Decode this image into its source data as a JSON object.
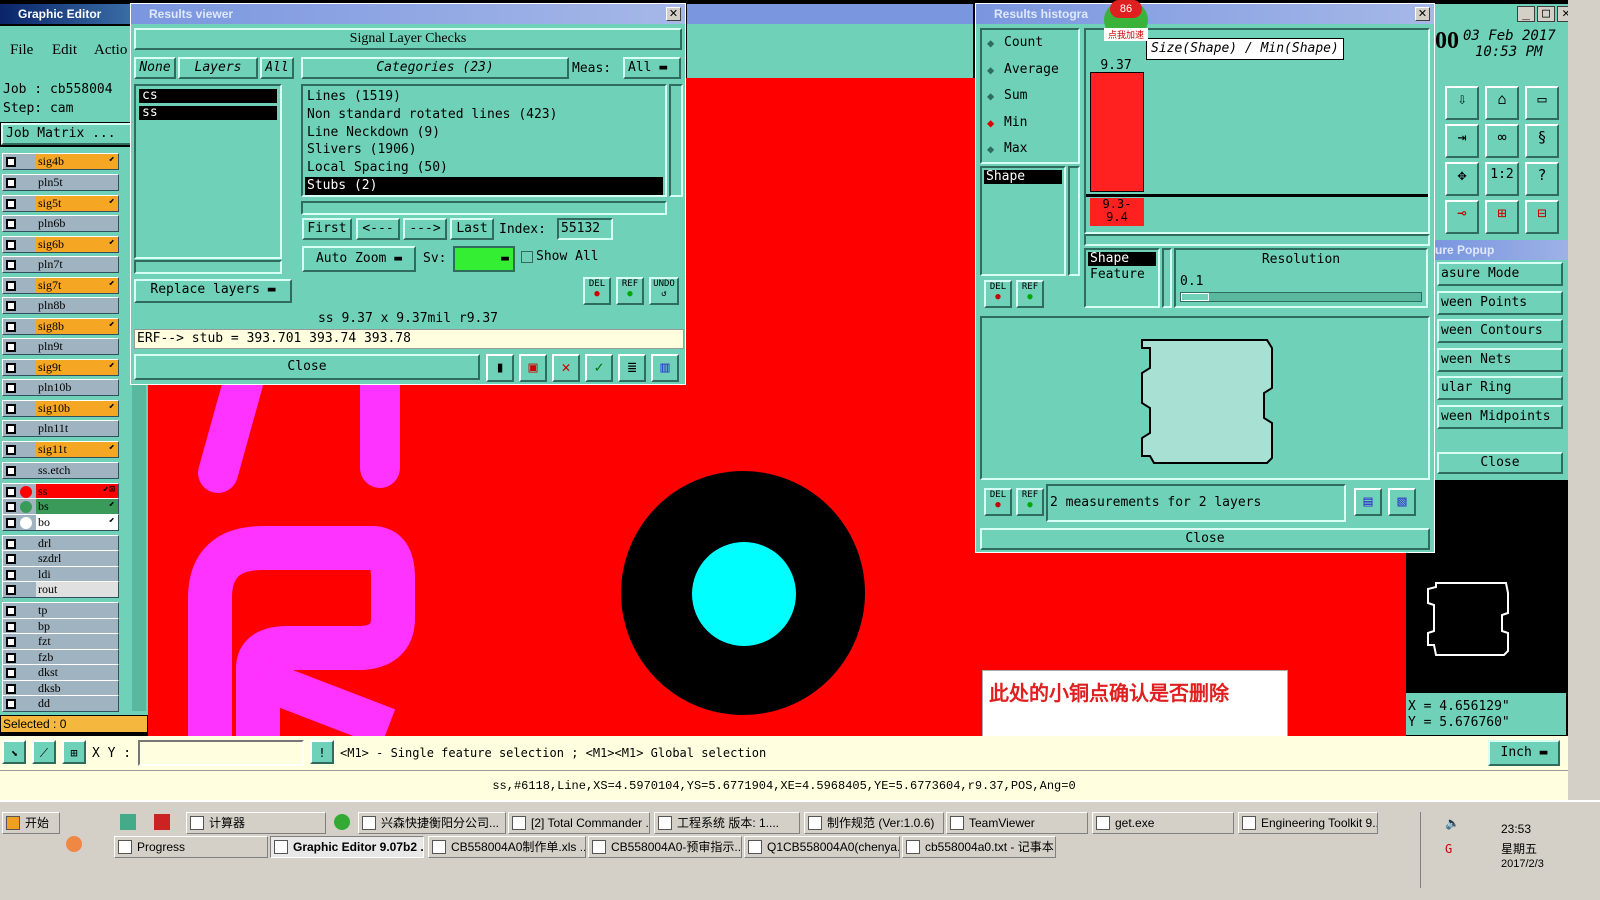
{
  "main": {
    "title": "Graphic Editor 9.07b",
    "menu": [
      "File",
      "Edit",
      "Actio"
    ],
    "job_label": "Job : cb558004",
    "step_label": "Step: cam",
    "job_matrix": "Job Matrix ...",
    "selected": "Selected : 0",
    "date": "03 Feb 2017",
    "time": "10:53 PM",
    "clock_digits": "00"
  },
  "layers": [
    {
      "name": "sig4b",
      "color": "#f5a623",
      "sym": "⬋"
    },
    {
      "name": "pln5t",
      "color": "#9fb3c0",
      "sym": ""
    },
    {
      "name": "sig5t",
      "color": "#f5a623",
      "sym": "⬋"
    },
    {
      "name": "pln6b",
      "color": "#9fb3c0",
      "sym": ""
    },
    {
      "name": "sig6b",
      "color": "#f5a623",
      "sym": "⬋"
    },
    {
      "name": "pln7t",
      "color": "#9fb3c0",
      "sym": ""
    },
    {
      "name": "sig7t",
      "color": "#f5a623",
      "sym": "⬋"
    },
    {
      "name": "pln8b",
      "color": "#9fb3c0",
      "sym": ""
    },
    {
      "name": "sig8b",
      "color": "#f5a623",
      "sym": "⬋"
    },
    {
      "name": "pln9t",
      "color": "#9fb3c0",
      "sym": ""
    },
    {
      "name": "sig9t",
      "color": "#f5a623",
      "sym": "⬋"
    },
    {
      "name": "pln10b",
      "color": "#9fb3c0",
      "sym": ""
    },
    {
      "name": "sig10b",
      "color": "#f5a623",
      "sym": "⬋"
    },
    {
      "name": "pln11t",
      "color": "#9fb3c0",
      "sym": ""
    },
    {
      "name": "sig11t",
      "color": "#f5a623",
      "sym": "⬋"
    },
    {
      "name": "ss.etch",
      "color": "#9fb3c0",
      "sym": ""
    },
    {
      "name": "ss",
      "color": "#ff0000",
      "sym": "⬋⊠"
    },
    {
      "name": "bs",
      "color": "#3a9a5a",
      "sym": "⬋"
    },
    {
      "name": "bo",
      "color": "#ffffff",
      "sym": "⬋"
    },
    {
      "name": "drl",
      "color": "#9fb3c0",
      "sym": ""
    },
    {
      "name": "szdrl",
      "color": "#9fb3c0",
      "sym": ""
    },
    {
      "name": "ldi",
      "color": "#9fb3c0",
      "sym": ""
    },
    {
      "name": "rout",
      "color": "#e0e0e0",
      "sym": ""
    },
    {
      "name": "tp",
      "color": "#9fb3c0",
      "sym": ""
    },
    {
      "name": "bp",
      "color": "#9fb3c0",
      "sym": ""
    },
    {
      "name": "fzt",
      "color": "#9fb3c0",
      "sym": ""
    },
    {
      "name": "fzb",
      "color": "#9fb3c0",
      "sym": ""
    },
    {
      "name": "dkst",
      "color": "#9fb3c0",
      "sym": ""
    },
    {
      "name": "dksb",
      "color": "#9fb3c0",
      "sym": ""
    },
    {
      "name": "dd",
      "color": "#9fb3c0",
      "sym": ""
    }
  ],
  "results": {
    "title": "Results viewer",
    "header": "Signal Layer Checks",
    "none": "None",
    "layers": "Layers",
    "all": "All",
    "categories_label": "Categories (23)",
    "meas_label": "Meas:",
    "meas_value": "All",
    "layer_list": [
      "cs",
      "ss"
    ],
    "categories": [
      "Lines (1519)",
      "Non standard rotated lines (423)",
      "Line Neckdown (9)",
      "Slivers (1906)",
      "Local Spacing (50)",
      "Stubs (2)"
    ],
    "first": "First",
    "prev": "<---",
    "next": "--->",
    "last": "Last",
    "index_label": "Index:",
    "index_value": "55132",
    "auto_zoom": "Auto Zoom",
    "sv": "Sv:",
    "show_all": "Show All",
    "replace_layers": "Replace layers",
    "del": "DEL",
    "ref": "REF",
    "undo": "UNDO",
    "size_info": "ss 9.37 x 9.37mil  r9.37",
    "erf_line": "ERF--> stub = 393.701 393.74 393.78",
    "close": "Close"
  },
  "histogram": {
    "title": "Results histogra",
    "stats": [
      "Count",
      "Average",
      "Sum",
      "Min",
      "Max"
    ],
    "selected_stat": "Min",
    "axis_title": "Size(Shape) / Min(Shape)",
    "bar_value": "9.37",
    "bar_label": "9.3-\n9.4",
    "shape": "Shape",
    "feature": "Feature",
    "resolution_label": "Resolution",
    "resolution_value": "0.1",
    "measurements": "2 measurements for 2 layers",
    "close": "Close",
    "badge": "86",
    "badge_label": "点我加速"
  },
  "popup": {
    "title": "ure Popup",
    "items": [
      "asure Mode",
      "ween Points",
      "ween Contours",
      "ween Nets",
      "ular Ring",
      "ween Midpoints"
    ],
    "close": "Close"
  },
  "coords": {
    "x": "X = 4.656129\"",
    "y": "Y = 5.676760\""
  },
  "annotation": "此处的小铜点确认是否删除",
  "bottom": {
    "xy_label": "X Y :",
    "hint": "<M1> - Single feature selection ; <M1><M1> Global selection",
    "units": "Inch",
    "status": "ss,#6118,Line,XS=4.5970104,YS=5.6771904,XE=4.5968405,YE=5.6773604,r9.37,POS,Ang=0"
  },
  "taskbar": {
    "start": "开始",
    "row1": [
      "计算器",
      "兴森快捷衡阳分公司...",
      "[2] Total Commander ...",
      "工程系统 版本: 1....",
      "制作规范 (Ver:1.0.6)",
      "TeamViewer",
      "get.exe",
      "Engineering Toolkit 9...."
    ],
    "row2": [
      "Progress",
      "Graphic Editor 9.07b2 ...",
      "CB558004A0制作单.xls ...",
      "CB558004A0-预审指示....",
      "Q1CB558004A0(chenya...",
      "cb558004a0.txt - 记事本"
    ],
    "time": "23:53",
    "weekday": "星期五",
    "date": "2017/2/3"
  }
}
